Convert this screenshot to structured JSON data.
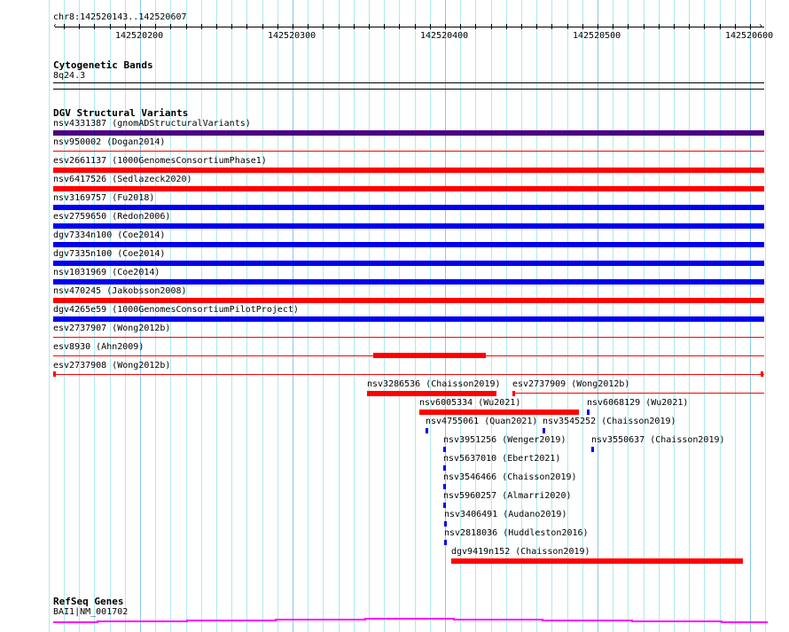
{
  "ruler": {
    "location": "chr8:142520143..142520607",
    "tick_labels": [
      "142520200",
      "142520300",
      "142520400",
      "142520500",
      "142520600"
    ]
  },
  "tracks": {
    "cytoband": {
      "title": "Cytogenetic Bands",
      "band": "8q24.3"
    },
    "dgv": {
      "title": "DGV Structural Variants",
      "features": [
        {
          "label": "nsv4331387 (gnomADStructuralVariants)",
          "color": "#4b0082"
        },
        {
          "label": "nsv950002 (Dogan2014)",
          "color": "#ff0000"
        },
        {
          "label": "esv2661137 (1000GenomesConsortiumPhase1)",
          "color": "#ff0000"
        },
        {
          "label": "nsv6417526 (Sedlazeck2020)",
          "color": "#ff0000"
        },
        {
          "label": "nsv3169757 (Fu2018)",
          "color": "#0000ee"
        },
        {
          "label": "esv2759650 (Redon2006)",
          "color": "#0000ee"
        },
        {
          "label": "dgv7334n100 (Coe2014)",
          "color": "#0000ee"
        },
        {
          "label": "dgv7335n100 (Coe2014)",
          "color": "#0000ee"
        },
        {
          "label": "nsv1031969 (Coe2014)",
          "color": "#0000ee"
        },
        {
          "label": "nsv470245 (Jakobsson2008)",
          "color": "#ff0000"
        },
        {
          "label": "dgv4265e59 (1000GenomesConsortiumPilotProject)",
          "color": "#0000ee"
        },
        {
          "label": "esv2737907 (Wong2012b)",
          "color": "#ff0000"
        },
        {
          "label": "esv8930 (Ahn2009)",
          "color": "#ff0000"
        },
        {
          "label": "esv2737908 (Wong2012b)",
          "color": "#ff0000"
        },
        {
          "label": "nsv3286536 (Chaisson2019)",
          "color": "#ff0000"
        },
        {
          "label": "esv2737909 (Wong2012b)",
          "color": "#ff0000"
        },
        {
          "label": "nsv6005334 (Wu2021)",
          "color": "#ff0000"
        },
        {
          "label": "nsv6068129 (Wu2021)",
          "color": "#0000ee"
        },
        {
          "label": "nsv4755061 (Quan2021)",
          "color": "#0000ee"
        },
        {
          "label": "nsv3545252 (Chaisson2019)",
          "color": "#0000ee"
        },
        {
          "label": "nsv3951256 (Wenger2019)",
          "color": "#0000ee"
        },
        {
          "label": "nsv3550637 (Chaisson2019)",
          "color": "#0000ee"
        },
        {
          "label": "nsv5637010 (Ebert2021)",
          "color": "#0000ee"
        },
        {
          "label": "nsv3546466 (Chaisson2019)",
          "color": "#0000ee"
        },
        {
          "label": "nsv5960257 (Almarri2020)",
          "color": "#0000ee"
        },
        {
          "label": "nsv3406491 (Audano2019)",
          "color": "#0000ee"
        },
        {
          "label": "nsv2818036 (Huddleston2016)",
          "color": "#0000ee"
        },
        {
          "label": "dgv9419n152 (Chaisson2019)",
          "color": "#ff0000"
        }
      ]
    },
    "refseq": {
      "title": "RefSeq Genes",
      "gene": "BAI1|NM_001702",
      "color": "#ff00ff"
    }
  }
}
